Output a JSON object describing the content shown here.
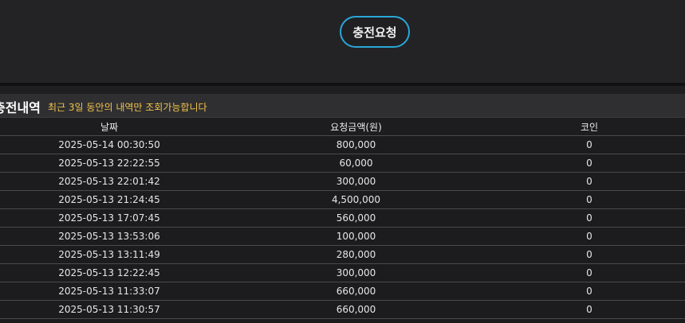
{
  "request_button_label": "충전요청",
  "section": {
    "title": "충전내역",
    "note": "최근 3일 동안의 내역만 조회가능합니다"
  },
  "table": {
    "headers": [
      "날짜",
      "요청금액(원)",
      "코인"
    ],
    "rows": [
      [
        "2025-05-14 00:30:50",
        "800,000",
        "0"
      ],
      [
        "2025-05-13 22:22:55",
        "60,000",
        "0"
      ],
      [
        "2025-05-13 22:01:42",
        "300,000",
        "0"
      ],
      [
        "2025-05-13 21:24:45",
        "4,500,000",
        "0"
      ],
      [
        "2025-05-13 17:07:45",
        "560,000",
        "0"
      ],
      [
        "2025-05-13 13:53:06",
        "100,000",
        "0"
      ],
      [
        "2025-05-13 13:11:49",
        "280,000",
        "0"
      ],
      [
        "2025-05-13 12:22:45",
        "300,000",
        "0"
      ],
      [
        "2025-05-13 11:33:07",
        "660,000",
        "0"
      ],
      [
        "2025-05-13 11:30:57",
        "660,000",
        "0"
      ]
    ]
  },
  "colors": {
    "button_border": "#2aa7d8",
    "note_text": "#f2c34a",
    "background": "#1b1b1d"
  }
}
